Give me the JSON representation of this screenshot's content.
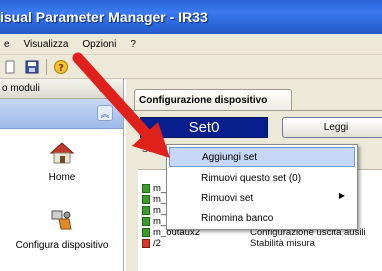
{
  "window": {
    "title": "isual Parameter Manager - IR33"
  },
  "menu": {
    "items": [
      "e",
      "Visualizza",
      "Opzioni",
      "?"
    ]
  },
  "toolbar": {
    "icons": [
      "new-icon",
      "save-icon",
      "help-icon"
    ]
  },
  "left_pane": {
    "header": "o moduli",
    "pin": "⊕",
    "collapse": "︽",
    "items": [
      {
        "label": "Home",
        "icon": "home-icon"
      },
      {
        "label": "Configura dispositivo",
        "icon": "configure-device-icon"
      }
    ]
  },
  "right_pane": {
    "tab": "Configurazione dispositivo",
    "set_value": "Set0",
    "read_button": "Leggi",
    "set_label": "Se",
    "rows": [
      {
        "name": "",
        "desc": "nzion",
        "icon": "green"
      },
      {
        "name": "m_",
        "desc": "comp",
        "icon": "green"
      },
      {
        "name": "m_",
        "desc": "defro",
        "icon": "green"
      },
      {
        "name": "m_",
        "desc": "venti",
        "icon": "green"
      },
      {
        "name": "m_",
        "desc": "ausili",
        "icon": "green"
      },
      {
        "name": "m_outaux2",
        "desc": "Configurazione uscita ausili",
        "icon": "green"
      },
      {
        "name": "/2",
        "desc": "Stabilità misura",
        "icon": "red"
      }
    ]
  },
  "context_menu": {
    "items": [
      {
        "label": "Aggiungi set",
        "highlighted": true,
        "submenu": false
      },
      {
        "label": "Rimuovi questo set (0)",
        "highlighted": false,
        "submenu": false
      },
      {
        "label": "Rimuovi set",
        "highlighted": false,
        "submenu": true
      },
      {
        "label": "Rinomina banco",
        "highlighted": false,
        "submenu": false
      }
    ],
    "submenu_arrow": "▶"
  },
  "colors": {
    "titlebar": "#2a62d6",
    "set_display_bg": "#0a1f8e",
    "highlight": "#c6d6f5",
    "annotation_arrow": "#e0201a"
  }
}
